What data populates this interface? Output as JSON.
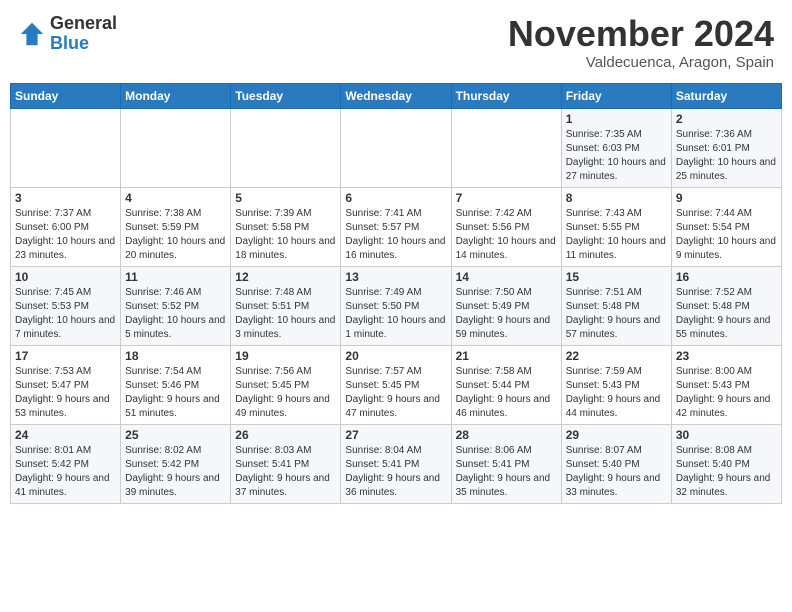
{
  "header": {
    "logo": {
      "general": "General",
      "blue": "Blue"
    },
    "month": "November 2024",
    "location": "Valdecuenca, Aragon, Spain"
  },
  "weekdays": [
    "Sunday",
    "Monday",
    "Tuesday",
    "Wednesday",
    "Thursday",
    "Friday",
    "Saturday"
  ],
  "weeks": [
    [
      {
        "day": "",
        "info": ""
      },
      {
        "day": "",
        "info": ""
      },
      {
        "day": "",
        "info": ""
      },
      {
        "day": "",
        "info": ""
      },
      {
        "day": "",
        "info": ""
      },
      {
        "day": "1",
        "info": "Sunrise: 7:35 AM\nSunset: 6:03 PM\nDaylight: 10 hours and 27 minutes."
      },
      {
        "day": "2",
        "info": "Sunrise: 7:36 AM\nSunset: 6:01 PM\nDaylight: 10 hours and 25 minutes."
      }
    ],
    [
      {
        "day": "3",
        "info": "Sunrise: 7:37 AM\nSunset: 6:00 PM\nDaylight: 10 hours and 23 minutes."
      },
      {
        "day": "4",
        "info": "Sunrise: 7:38 AM\nSunset: 5:59 PM\nDaylight: 10 hours and 20 minutes."
      },
      {
        "day": "5",
        "info": "Sunrise: 7:39 AM\nSunset: 5:58 PM\nDaylight: 10 hours and 18 minutes."
      },
      {
        "day": "6",
        "info": "Sunrise: 7:41 AM\nSunset: 5:57 PM\nDaylight: 10 hours and 16 minutes."
      },
      {
        "day": "7",
        "info": "Sunrise: 7:42 AM\nSunset: 5:56 PM\nDaylight: 10 hours and 14 minutes."
      },
      {
        "day": "8",
        "info": "Sunrise: 7:43 AM\nSunset: 5:55 PM\nDaylight: 10 hours and 11 minutes."
      },
      {
        "day": "9",
        "info": "Sunrise: 7:44 AM\nSunset: 5:54 PM\nDaylight: 10 hours and 9 minutes."
      }
    ],
    [
      {
        "day": "10",
        "info": "Sunrise: 7:45 AM\nSunset: 5:53 PM\nDaylight: 10 hours and 7 minutes."
      },
      {
        "day": "11",
        "info": "Sunrise: 7:46 AM\nSunset: 5:52 PM\nDaylight: 10 hours and 5 minutes."
      },
      {
        "day": "12",
        "info": "Sunrise: 7:48 AM\nSunset: 5:51 PM\nDaylight: 10 hours and 3 minutes."
      },
      {
        "day": "13",
        "info": "Sunrise: 7:49 AM\nSunset: 5:50 PM\nDaylight: 10 hours and 1 minute."
      },
      {
        "day": "14",
        "info": "Sunrise: 7:50 AM\nSunset: 5:49 PM\nDaylight: 9 hours and 59 minutes."
      },
      {
        "day": "15",
        "info": "Sunrise: 7:51 AM\nSunset: 5:48 PM\nDaylight: 9 hours and 57 minutes."
      },
      {
        "day": "16",
        "info": "Sunrise: 7:52 AM\nSunset: 5:48 PM\nDaylight: 9 hours and 55 minutes."
      }
    ],
    [
      {
        "day": "17",
        "info": "Sunrise: 7:53 AM\nSunset: 5:47 PM\nDaylight: 9 hours and 53 minutes."
      },
      {
        "day": "18",
        "info": "Sunrise: 7:54 AM\nSunset: 5:46 PM\nDaylight: 9 hours and 51 minutes."
      },
      {
        "day": "19",
        "info": "Sunrise: 7:56 AM\nSunset: 5:45 PM\nDaylight: 9 hours and 49 minutes."
      },
      {
        "day": "20",
        "info": "Sunrise: 7:57 AM\nSunset: 5:45 PM\nDaylight: 9 hours and 47 minutes."
      },
      {
        "day": "21",
        "info": "Sunrise: 7:58 AM\nSunset: 5:44 PM\nDaylight: 9 hours and 46 minutes."
      },
      {
        "day": "22",
        "info": "Sunrise: 7:59 AM\nSunset: 5:43 PM\nDaylight: 9 hours and 44 minutes."
      },
      {
        "day": "23",
        "info": "Sunrise: 8:00 AM\nSunset: 5:43 PM\nDaylight: 9 hours and 42 minutes."
      }
    ],
    [
      {
        "day": "24",
        "info": "Sunrise: 8:01 AM\nSunset: 5:42 PM\nDaylight: 9 hours and 41 minutes."
      },
      {
        "day": "25",
        "info": "Sunrise: 8:02 AM\nSunset: 5:42 PM\nDaylight: 9 hours and 39 minutes."
      },
      {
        "day": "26",
        "info": "Sunrise: 8:03 AM\nSunset: 5:41 PM\nDaylight: 9 hours and 37 minutes."
      },
      {
        "day": "27",
        "info": "Sunrise: 8:04 AM\nSunset: 5:41 PM\nDaylight: 9 hours and 36 minutes."
      },
      {
        "day": "28",
        "info": "Sunrise: 8:06 AM\nSunset: 5:41 PM\nDaylight: 9 hours and 35 minutes."
      },
      {
        "day": "29",
        "info": "Sunrise: 8:07 AM\nSunset: 5:40 PM\nDaylight: 9 hours and 33 minutes."
      },
      {
        "day": "30",
        "info": "Sunrise: 8:08 AM\nSunset: 5:40 PM\nDaylight: 9 hours and 32 minutes."
      }
    ]
  ]
}
